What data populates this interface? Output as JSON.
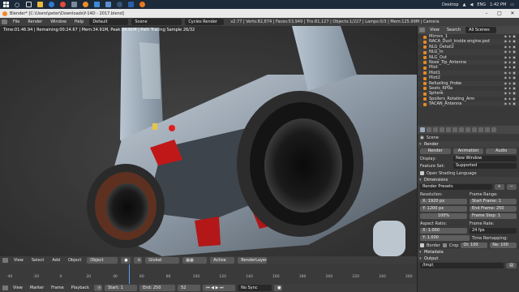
{
  "taskbar": {
    "desktop_label": "Desktop",
    "lang": "ENG",
    "time": "1:42 PM",
    "icons": [
      "windows-logo",
      "search",
      "task-view",
      "file-explorer",
      "edge",
      "chrome",
      "settings",
      "blender",
      "store",
      "mail",
      "steam",
      "photoshop",
      "blender-2"
    ]
  },
  "titlebar": {
    "title": "Blender* [C:\\Users\\peter\\Downloads\\f-14D - 2017.blend]"
  },
  "infobar": {
    "menus": [
      "File",
      "Render",
      "Window",
      "Help"
    ],
    "screen": "Default",
    "scene": "Scene",
    "engine": "Cycles Render",
    "stats": "v2.77 | Verts:82,874 | Faces:53,949 | Tris:81,127 | Objects:1/227 | Lamps:0/3 | Mem:125.99M | Camera"
  },
  "viewport": {
    "status": "Time:01:46.94 | Remaining:00:24.67 | Mem:34.91M, Peak:34.91M | Path Tracing Sample 26/32"
  },
  "vp_header": {
    "items": [
      "View",
      "Select",
      "Add",
      "Object"
    ],
    "mode": "Object Mode",
    "pivot": "Global",
    "layer_label": "Active",
    "render_layer": "RenderLayer"
  },
  "timeline": {
    "ticks": [
      "-40",
      "-20",
      "0",
      "20",
      "40",
      "60",
      "80",
      "100",
      "120",
      "140",
      "160",
      "180",
      "200",
      "220",
      "240",
      "260"
    ],
    "current_frame": 52
  },
  "tl_header": {
    "items": [
      "View",
      "Marker",
      "Frame",
      "Playback"
    ],
    "start": "Start: 1",
    "end": "End: 250",
    "frame": "52",
    "sync": "No Sync"
  },
  "outliner": {
    "header": [
      "View",
      "Search",
      "All Scenes"
    ],
    "items": [
      "Mirrors_1",
      "NACA_Duct_inside engine.psd",
      "NLG_Detail2",
      "NLG_In",
      "NLG_Out",
      "Nose_Tip_Antenna",
      "Pilot",
      "Pilot1",
      "Pilot2",
      "Refueling_Probe",
      "Seats_RP0a",
      "Sphere",
      "Spoilers_Rotating_Arm",
      "TACAN_Antenna"
    ]
  },
  "props": {
    "scene_label": "Scene",
    "render_section": "Render",
    "render_btn": "Render",
    "anim_btn": "Animation",
    "audio_btn": "Audio",
    "display_label": "Display:",
    "display_value": "New Window",
    "feature_label": "Feature Set:",
    "feature_value": "Supported",
    "osl_label": "Open Shading Language",
    "dimensions_section": "Dimensions",
    "presets": "Render Presets",
    "resolution_label": "Resolution:",
    "frame_range_label": "Frame Range:",
    "res_x": "X: 1920 px",
    "res_y": "Y: 1200 px",
    "res_pct": "100%",
    "start_frame": "Start Frame: 1",
    "end_frame": "End Frame: 250",
    "frame_step": "Frame Step: 1",
    "aspect_label": "Aspect Ratio:",
    "frame_rate_label": "Frame Rate:",
    "aspect_x": "X: 1.000",
    "aspect_y": "Y: 1.000",
    "fps": "24 fps",
    "time_remap_label": "Time Remapping:",
    "border": "Border",
    "crop": "Crop",
    "old": "Ol: 100",
    "new": "Ne: 100",
    "metadata_section": "Metadata",
    "output_section": "Output",
    "output_path": "/tmp\\"
  },
  "colors": {
    "accent": "#57a0ff",
    "taskbar": "#1c2a3a",
    "panel": "#393939"
  }
}
